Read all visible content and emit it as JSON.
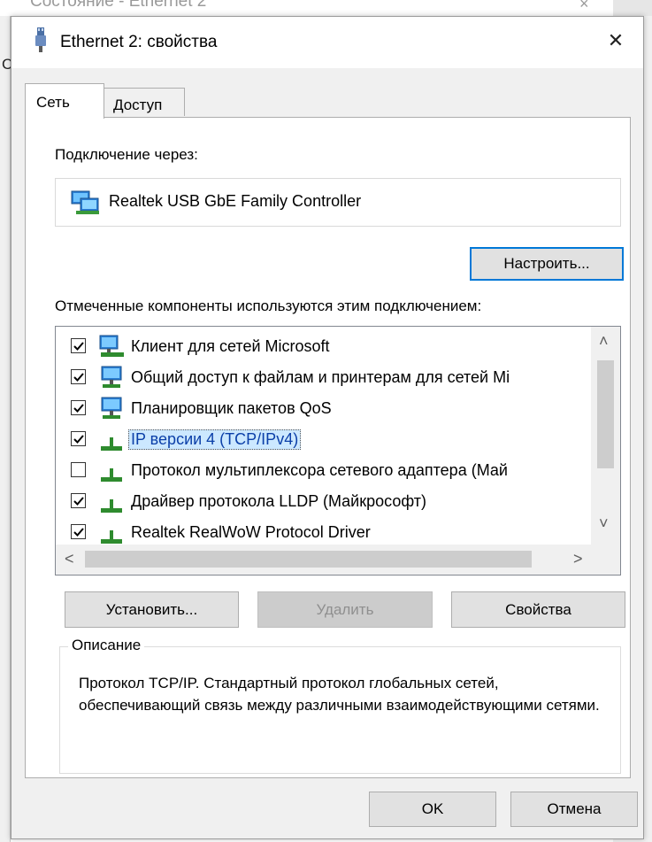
{
  "background_window": {
    "title": "Состояние - Ethernet 2",
    "close_glyph": "×",
    "partial_letter": "С"
  },
  "dialog": {
    "title": "Ethernet 2: свойства",
    "close_glyph": "✕",
    "tabs": [
      {
        "label": "Сеть",
        "active": true
      },
      {
        "label": "Доступ",
        "active": false
      }
    ],
    "connect_via_label": "Подключение через:",
    "adapter_name": "Realtek USB GbE Family Controller",
    "configure_button": "Настроить...",
    "components_label": "Отмеченные компоненты используются этим подключением:",
    "components": [
      {
        "label": "Клиент для сетей Microsoft",
        "checked": true,
        "icon": "network-client-icon",
        "selected": false
      },
      {
        "label": "Общий доступ к файлам и принтерам для сетей Mi",
        "checked": true,
        "icon": "network-service-icon",
        "selected": false
      },
      {
        "label": "Планировщик пакетов QoS",
        "checked": true,
        "icon": "network-service-icon",
        "selected": false
      },
      {
        "label": "IP версии 4 (TCP/IPv4)",
        "checked": true,
        "icon": "protocol-icon",
        "selected": true
      },
      {
        "label": "Протокол мультиплексора сетевого адаптера (Май",
        "checked": false,
        "icon": "protocol-icon",
        "selected": false
      },
      {
        "label": "Драйвер протокола LLDP (Майкрософт)",
        "checked": true,
        "icon": "protocol-icon",
        "selected": false
      },
      {
        "label": "Realtek RealWoW Protocol Driver",
        "checked": true,
        "icon": "protocol-icon",
        "selected": false
      }
    ],
    "scroll_arrows": {
      "up": "˄",
      "down": "˅",
      "left": "<",
      "right": ">"
    },
    "install_button": "Установить...",
    "remove_button": "Удалить",
    "properties_button": "Свойства",
    "description_label": "Описание",
    "description_text": "Протокол TCP/IP. Стандартный протокол глобальных сетей, обеспечивающий связь между различными взаимодействующими сетями.",
    "ok_button": "OK",
    "cancel_button": "Отмена"
  },
  "colors": {
    "dialog_bg": "#f0f0f0",
    "focus_border": "#0078d7",
    "selection_bg": "#cce8ff",
    "selection_text": "#0b3fa8"
  }
}
